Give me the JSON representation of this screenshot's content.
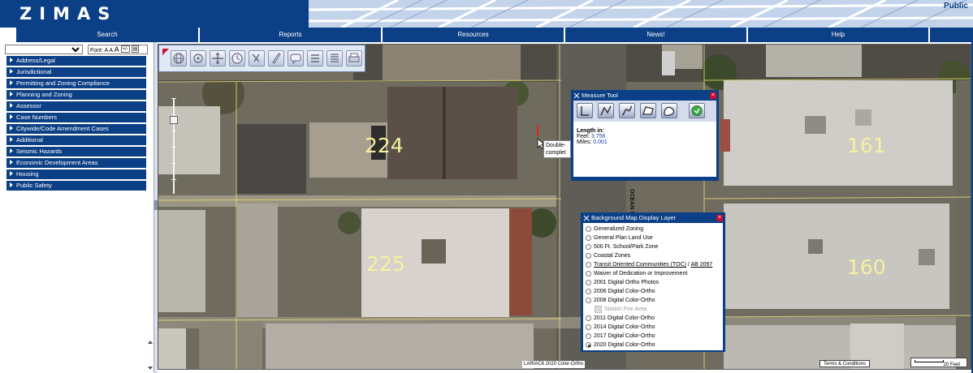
{
  "header": {
    "logo": "ZIMAS",
    "public_label": "Public"
  },
  "nav": {
    "tabs": [
      {
        "label": "Search"
      },
      {
        "label": "Reports"
      },
      {
        "label": "Resources"
      },
      {
        "label": "News!"
      },
      {
        "label": "Help"
      }
    ]
  },
  "left_panel": {
    "search_select_value": "",
    "font_label": "Font:",
    "font_small": "A",
    "font_medium": "A",
    "font_large": "A",
    "font_decrease": "+/-",
    "categories": [
      {
        "label": "Address/Legal"
      },
      {
        "label": "Jurisdictional"
      },
      {
        "label": "Permitting and Zoning Compliance"
      },
      {
        "label": "Planning and Zoning"
      },
      {
        "label": "Assessor"
      },
      {
        "label": "Case Numbers"
      },
      {
        "label": "Citywide/Code Amendment Cases"
      },
      {
        "label": "Additional"
      },
      {
        "label": "Seismic Hazards"
      },
      {
        "label": "Economic Development Areas"
      },
      {
        "label": "Housing"
      },
      {
        "label": "Public Safety"
      }
    ]
  },
  "map": {
    "parcels": [
      {
        "label": "224"
      },
      {
        "label": "225"
      },
      {
        "label": "161"
      },
      {
        "label": "160"
      }
    ],
    "street_label": "OCEAN ST",
    "tooltip_line1": "Double-",
    "tooltip_line2": "complet",
    "copyright": "LARIAC6 2020 Color-Ortho",
    "terms": "Terms & Conditions",
    "scale_label": "20 Feet",
    "zoom_level": 0.2
  },
  "measure_tool": {
    "title": "Measure Tool",
    "result_heading": "Length in:",
    "feet_label": "Feet:",
    "feet_value": "3.756",
    "miles_label": "Miles:",
    "miles_value": "0.001"
  },
  "background_panel": {
    "title": "Background Map Display Layer",
    "options": [
      {
        "label": "Generalized Zoning",
        "selected": false
      },
      {
        "label": "General Plan Land Use",
        "selected": false
      },
      {
        "label": "500 Ft. School/Park Zone",
        "selected": false
      },
      {
        "label": "Coastal Zones",
        "selected": false
      },
      {
        "label": "Transit Oriented Communities (TOC)",
        "link2": "AB 2097",
        "selected": false
      },
      {
        "label": "Waiver of Dedication or Improvement",
        "selected": false
      },
      {
        "label": "2001 Digital Ortho Photos",
        "selected": false
      },
      {
        "label": "2006 Digital Color-Ortho",
        "selected": false
      },
      {
        "label": "2008 Digital Color-Ortho",
        "selected": false
      },
      {
        "label": "Station Fire Area",
        "selected": false,
        "disabled": true
      },
      {
        "label": "2011 Digital Color-Ortho",
        "selected": false
      },
      {
        "label": "2014 Digital Color-Ortho",
        "selected": false
      },
      {
        "label": "2017 Digital Color-Ortho",
        "selected": false
      },
      {
        "label": "2020 Digital Color-Ortho",
        "selected": true
      }
    ]
  },
  "colors": {
    "brand_blue": "#0b3f86",
    "close_red": "#c8102e",
    "parcel_label": "#f7f0a0"
  }
}
